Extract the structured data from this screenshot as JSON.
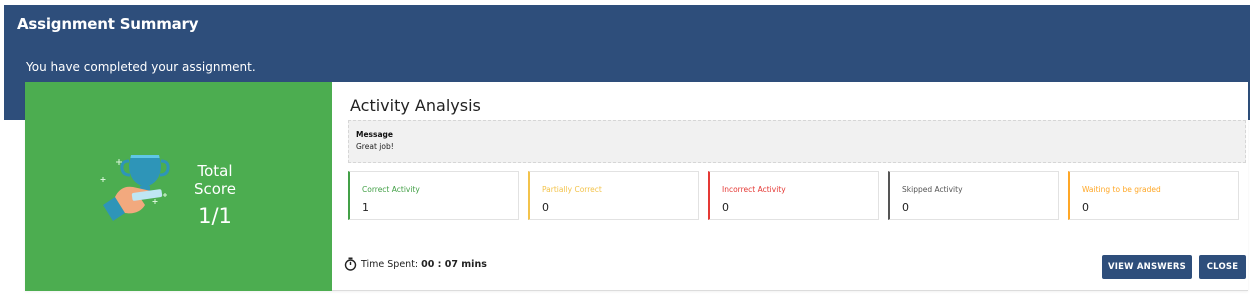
{
  "header": {
    "title": "Assignment Summary",
    "subtitle": "You have completed your assignment."
  },
  "score": {
    "label": "Total Score",
    "value": "1/1",
    "icon": "trophy-icon",
    "panel_color": "#4cad50"
  },
  "analysis": {
    "title": "Activity Analysis",
    "message_label": "Message",
    "message_text": "Great job!",
    "stats": [
      {
        "label": "Correct Activity",
        "value": "1",
        "color": "#43a047"
      },
      {
        "label": "Partially Correct",
        "value": "0",
        "color": "#f3c34b"
      },
      {
        "label": "Incorrect Activity",
        "value": "0",
        "color": "#e53935"
      },
      {
        "label": "Skipped Activity",
        "value": "0",
        "color": "#555555"
      },
      {
        "label": "Waiting to be graded",
        "value": "0",
        "color": "#ffa726"
      }
    ]
  },
  "footer": {
    "time_label": "Time Spent:",
    "time_value": "00 : 07 mins",
    "view_answers_label": "VIEW ANSWERS",
    "close_label": "CLOSE"
  },
  "colors": {
    "header_bg": "#2e4e7b",
    "button_bg": "#2e4e7b"
  }
}
